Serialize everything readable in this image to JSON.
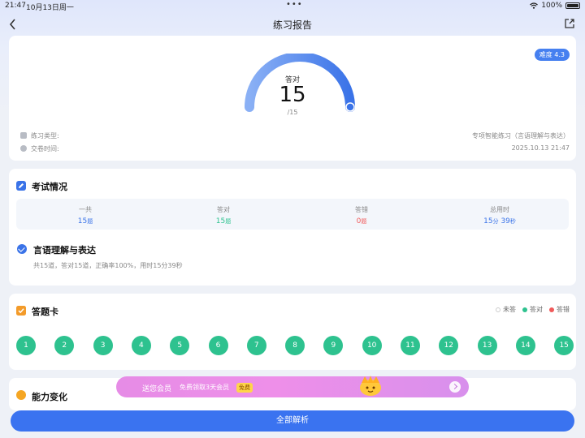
{
  "status_bar": {
    "time": "21:47",
    "date": "10月13日周一",
    "dots": "•••",
    "battery": "100%"
  },
  "nav": {
    "title": "练习报告"
  },
  "summary": {
    "difficulty": "难度 4.3",
    "gauge_label": "答对",
    "correct": "15",
    "total": "/15",
    "score_fraction": 1.0,
    "practice_type_label": "练习类型:",
    "practice_type_value": "专项智能练习（言语理解与表达）",
    "submit_time_label": "交卷时间:",
    "submit_time_value": "2025.10.13 21:47",
    "gauge_color_start": "#8ab0f5",
    "gauge_color_end": "#3a73e8"
  },
  "exam": {
    "title": "考试情况",
    "stats": [
      {
        "label": "一共",
        "value": "15",
        "unit": "题",
        "color": "#3a73e8"
      },
      {
        "label": "答对",
        "value": "15",
        "unit": "题",
        "color": "#2ec28f"
      },
      {
        "label": "答错",
        "value": "0",
        "unit": "题",
        "color": "#f05a5a"
      },
      {
        "label": "总用时",
        "value": "15",
        "unit": "分",
        "value2": "39",
        "unit2": "秒",
        "color": "#3a73e8"
      }
    ],
    "subject": "言语理解与表达",
    "subject_desc": "共15道，答对15道，正确率100%，用时15分39秒"
  },
  "answer_card": {
    "title": "答题卡",
    "legend": {
      "unanswered": "未答",
      "correct": "答对",
      "wrong": "答错"
    },
    "questions": [
      "1",
      "2",
      "3",
      "4",
      "5",
      "6",
      "7",
      "8",
      "9",
      "10",
      "11",
      "12",
      "13",
      "14",
      "15"
    ]
  },
  "promo": {
    "text1": "送您会员",
    "text2": "免费领取3天会员",
    "badge": "免费"
  },
  "ability": {
    "title": "能力变化"
  },
  "bottom_button": {
    "label": "全部解析"
  }
}
